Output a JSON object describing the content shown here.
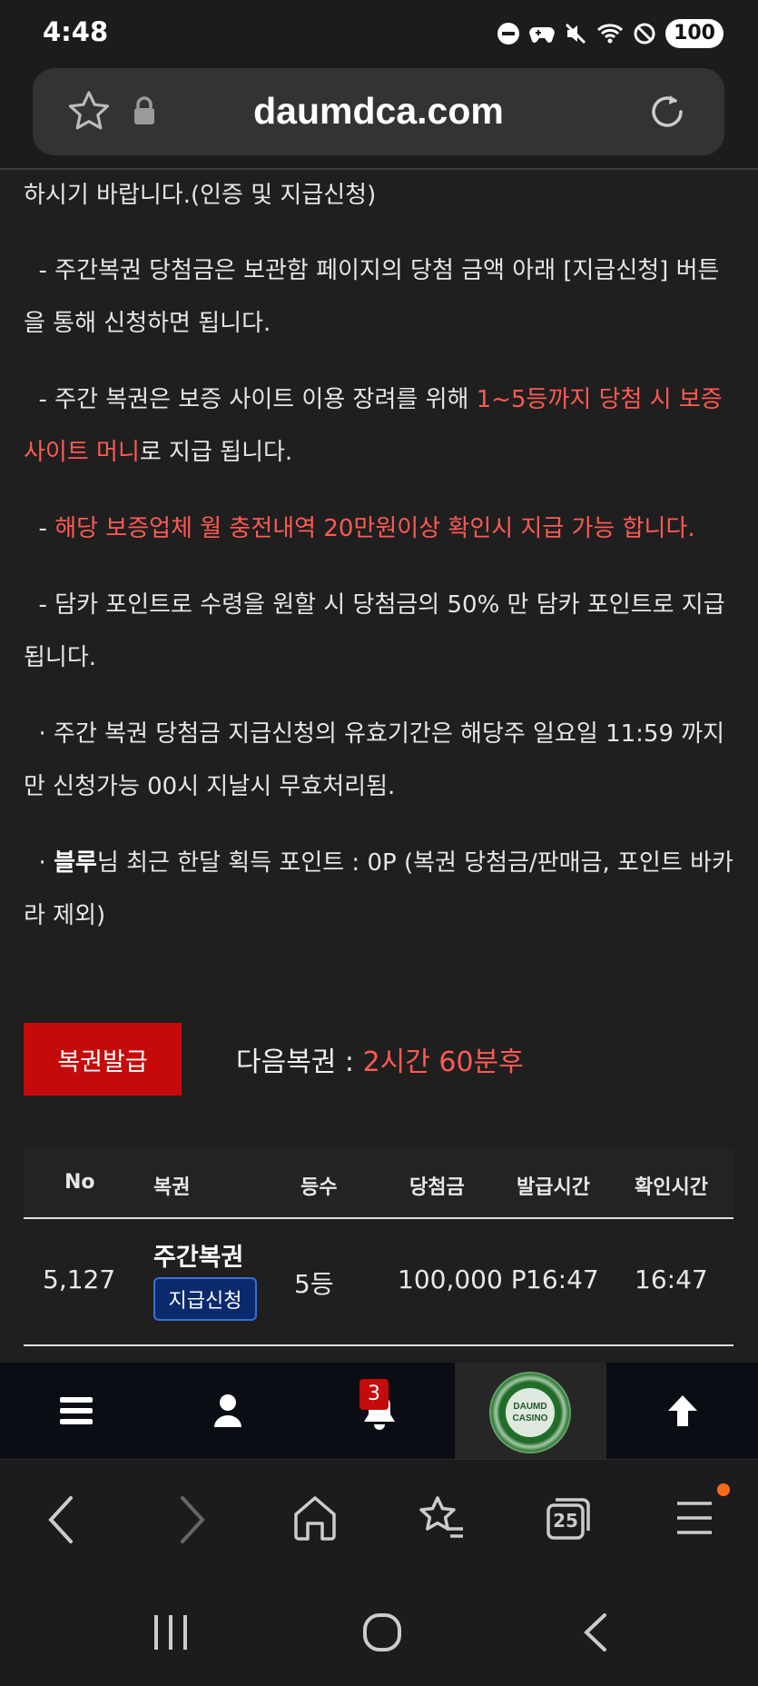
{
  "status_bar": {
    "time": "4:48",
    "battery": "100"
  },
  "browser": {
    "url": "daumdca.com"
  },
  "content": {
    "intro_line": "하시기 바랍니다.(인증 및 지급신청)",
    "para1": "  - 주간복권 당첨금은 보관함 페이지의 당첨 금액 아래 [지급신청] 버튼을 통해 신청하면 됩니다.",
    "para2_before": "  - 주간 복권은 보증 사이트 이용 장려를 위해 ",
    "para2_highlight": "1~5등까지 당첨 시 보증사이트 머니",
    "para2_after": "로 지급 됩니다.",
    "para3_prefix": "  - ",
    "para3_highlight": "해당 보증업체 월 충전내역 20만원이상 확인시 지급 가능 합니다.",
    "para4": "  - 담카 포인트로 수령을 원할 시 당첨금의 50% 만 담카 포인트로 지급 됩니다.",
    "para5": "  · 주간 복권 당첨금 지급신청의 유효기간은 해당주 일요일 11:59 까지만 신청가능 00시 지날시 무효처리됨.",
    "para6_prefix": "  · ",
    "para6_user": "블루",
    "para6_rest": "님 최근 한달 획득 포인트 : 0P (복권 당첨금/판매금, 포인트 바카라 제외)"
  },
  "issue": {
    "button_label": "복권발급",
    "next_label": "다음복권 : ",
    "next_value": "2시간 60분후"
  },
  "table": {
    "headers": [
      "No",
      "복권",
      "등수",
      "당첨금",
      "발급시간",
      "확인시간"
    ],
    "rows": [
      {
        "no": "5,127",
        "ticket": "주간복권",
        "claim_label": "지급신청",
        "rank": "5등",
        "prize": "100,000 P",
        "issued": "16:47",
        "checked": "16:47"
      }
    ]
  },
  "site_nav": {
    "notification_count": "3",
    "logo_text_1": "DAUMD",
    "logo_text_2": "CASINO"
  },
  "browser_toolbar": {
    "tabs_count": "25"
  },
  "colors": {
    "accent_red": "#c40a0a",
    "highlight_red": "#ff5a54",
    "claim_blue": "#0b2a6e"
  }
}
